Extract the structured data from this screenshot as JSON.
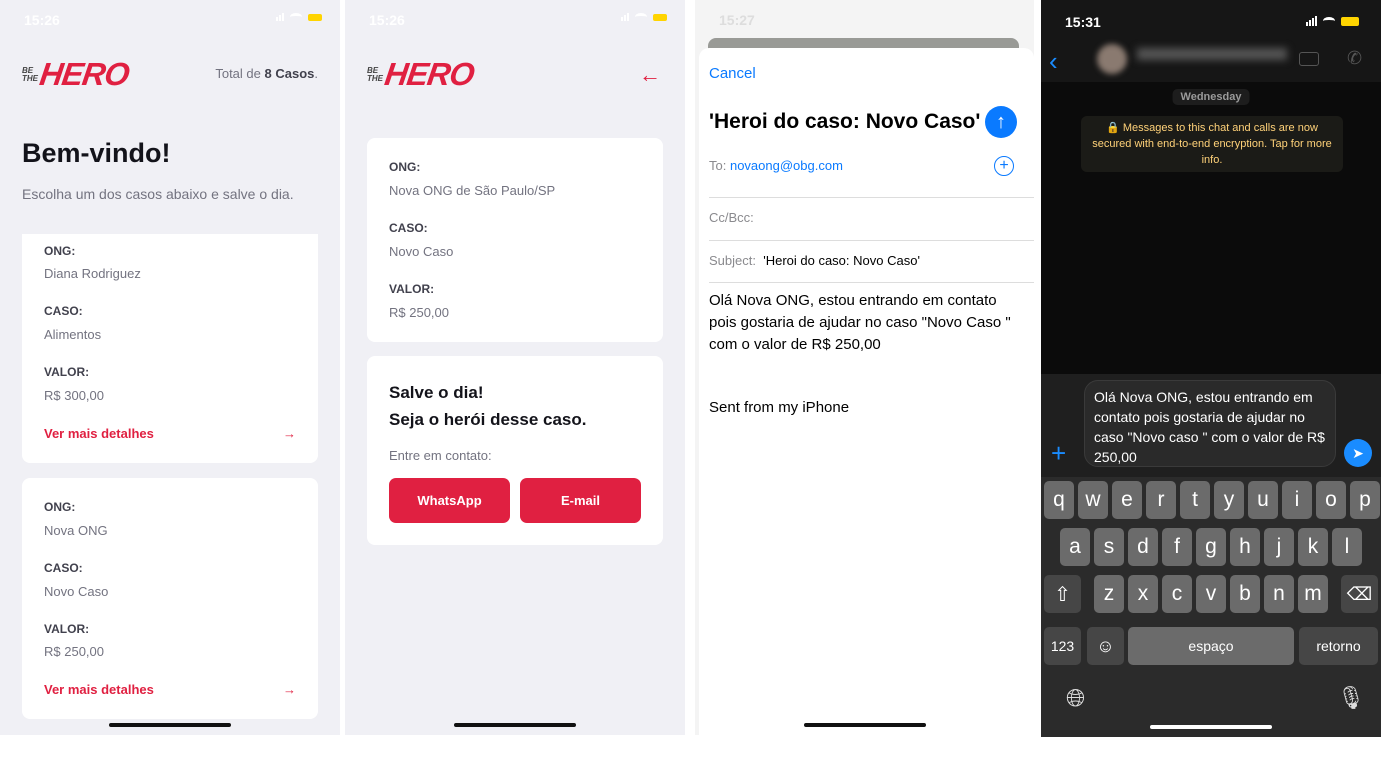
{
  "screen1": {
    "time": "15:26",
    "logo": {
      "small": "BE THE",
      "big": "HERO"
    },
    "total_prefix": "Total de ",
    "total_count": "8 Casos",
    "total_suffix": ".",
    "title": "Bem-vindo!",
    "subtitle": "Escolha um dos casos abaixo e salve o dia.",
    "cases": [
      {
        "ong_label": "ONG:",
        "ong": "Diana Rodriguez",
        "caso_label": "CASO:",
        "caso": "Alimentos",
        "valor_label": "VALOR:",
        "valor": "R$ 300,00",
        "link": "Ver mais detalhes"
      },
      {
        "ong_label": "ONG:",
        "ong": "Nova ONG",
        "caso_label": "CASO:",
        "caso": "Novo Caso",
        "valor_label": "VALOR:",
        "valor": "R$ 250,00",
        "link": "Ver mais detalhes"
      }
    ]
  },
  "screen2": {
    "time": "15:26",
    "logo": {
      "small": "BE THE",
      "big": "HERO"
    },
    "ong_label": "ONG:",
    "ong": "Nova ONG de São Paulo/SP",
    "caso_label": "CASO:",
    "caso": "Novo Caso",
    "valor_label": "VALOR:",
    "valor": "R$ 250,00",
    "cta1": "Salve o dia!",
    "cta2": "Seja o herói desse caso.",
    "contact": "Entre em contato:",
    "whatsapp": "WhatsApp",
    "email": "E-mail"
  },
  "screen3": {
    "time": "15:27",
    "cancel": "Cancel",
    "subject_title": "'Heroi do caso: Novo Caso'",
    "to_label": "To:",
    "to": "novaong@obg.com",
    "ccbcc": "Cc/Bcc:",
    "subject_label": "Subject:",
    "subject": "'Heroi do caso: Novo Caso'",
    "body": "Olá Nova ONG, estou entrando em contato pois gostaria de ajudar no caso  \"Novo Caso \" com o valor de R$ 250,00",
    "signature": "Sent from my iPhone"
  },
  "screen4": {
    "time": "15:31",
    "day": "Wednesday",
    "encryption": "Messages to this chat and calls are now secured with end-to-end encryption. Tap for more info.",
    "message": "Olá Nova ONG, estou entrando em contato pois gostaria de ajudar no caso  \"Novo caso \" com o valor de R$ 250,00",
    "keys_row1": [
      "q",
      "w",
      "e",
      "r",
      "t",
      "y",
      "u",
      "i",
      "o",
      "p"
    ],
    "keys_row2": [
      "a",
      "s",
      "d",
      "f",
      "g",
      "h",
      "j",
      "k",
      "l"
    ],
    "keys_row3": [
      "z",
      "x",
      "c",
      "v",
      "b",
      "n",
      "m"
    ],
    "key_123": "123",
    "key_space": "espaço",
    "key_return": "retorno"
  },
  "colors": {
    "brand": "#e02041",
    "ios_blue": "#0a7aff",
    "whatsapp_accent": "#ffd279"
  }
}
